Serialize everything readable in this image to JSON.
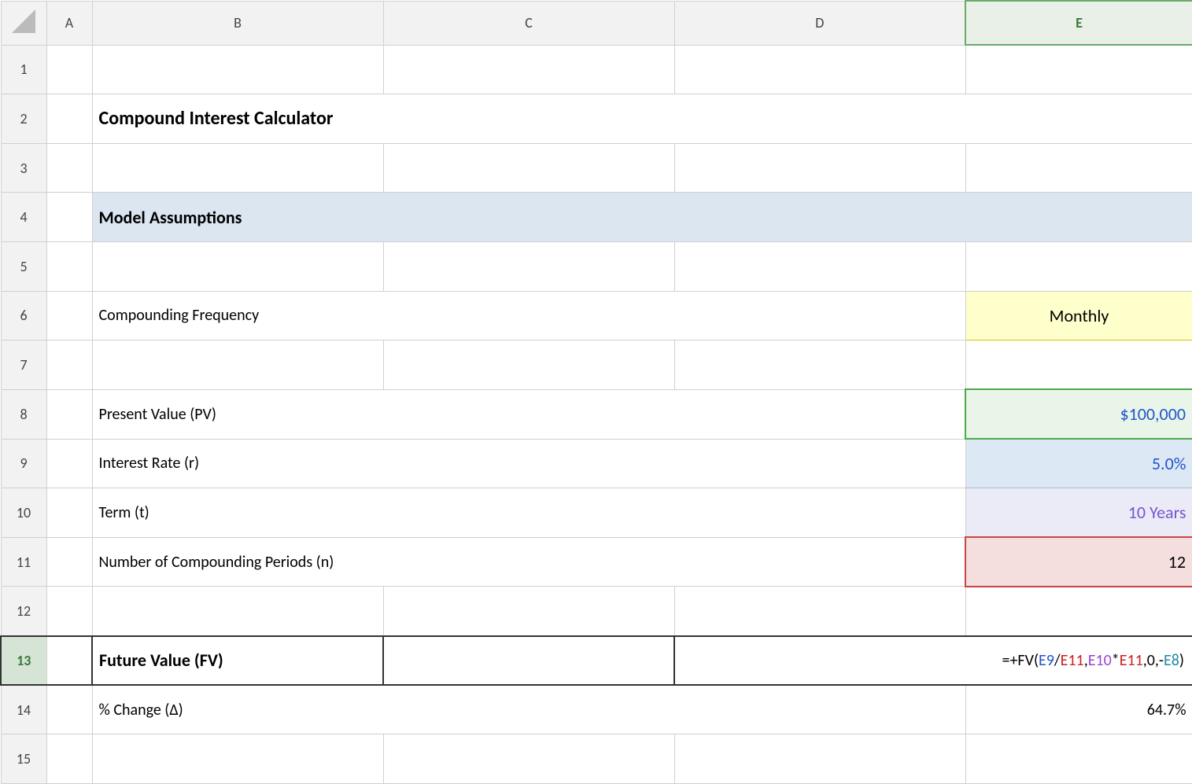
{
  "columns": {
    "corner": "",
    "a": "A",
    "b": "B",
    "c": "C",
    "d": "D",
    "e": "E"
  },
  "rows": {
    "r1": {
      "num": "1"
    },
    "r2": {
      "num": "2",
      "b": "Compound Interest Calculator"
    },
    "r3": {
      "num": "3"
    },
    "r4": {
      "num": "4",
      "b": "Model Assumptions"
    },
    "r5": {
      "num": "5"
    },
    "r6": {
      "num": "6",
      "b": "Compounding Frequency",
      "e": "Monthly"
    },
    "r7": {
      "num": "7"
    },
    "r8": {
      "num": "8",
      "b": "Present Value (PV)",
      "e": "$100,000"
    },
    "r9": {
      "num": "9",
      "b": "Interest Rate (r)",
      "e": "5.0%"
    },
    "r10": {
      "num": "10",
      "b": "Term (t)",
      "e": "10 Years"
    },
    "r11": {
      "num": "11",
      "b": "Number of Compounding Periods (n)",
      "e": "12"
    },
    "r12": {
      "num": "12"
    },
    "r13": {
      "num": "13",
      "b": "Future Value (FV)",
      "formula_prefix": "=+FV(",
      "formula_e9": "E9",
      "formula_slash": "/",
      "formula_e11a": "E11",
      "formula_comma": ",",
      "formula_e10": "E10",
      "formula_star": "*",
      "formula_e11b": "E11",
      "formula_suffix": ",0,-",
      "formula_e8": "E8",
      "formula_close": ")"
    },
    "r14": {
      "num": "14",
      "b": "% Change (Δ)",
      "e": "64.7%"
    },
    "r15": {
      "num": "15"
    }
  }
}
